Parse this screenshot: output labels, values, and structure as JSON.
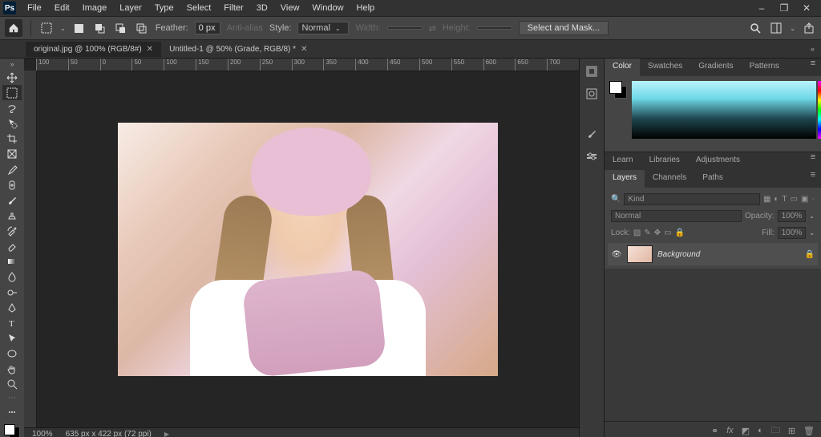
{
  "menu": [
    "File",
    "Edit",
    "Image",
    "Layer",
    "Type",
    "Select",
    "Filter",
    "3D",
    "View",
    "Window",
    "Help"
  ],
  "options": {
    "feather_label": "Feather:",
    "feather_value": "0 px",
    "antialias": "Anti-alias",
    "style_label": "Style:",
    "style_value": "Normal",
    "width_label": "Width:",
    "height_label": "Height:",
    "mask_button": "Select and Mask..."
  },
  "tabs": [
    {
      "title": "original.jpg @ 100% (RGB/8#)",
      "active": true
    },
    {
      "title": "Untitled-1 @ 50% (Grade, RGB/8) *",
      "active": false
    }
  ],
  "ruler_ticks": [
    "100",
    "50",
    "0",
    "50",
    "100",
    "150",
    "200",
    "250",
    "300",
    "350",
    "400",
    "450",
    "500",
    "550",
    "600",
    "650",
    "700"
  ],
  "status": {
    "zoom": "100%",
    "dims": "635 px x 422 px (72 ppi)"
  },
  "right": {
    "color_tabs": [
      "Color",
      "Swatches",
      "Gradients",
      "Patterns"
    ],
    "mid_tabs": [
      "Learn",
      "Libraries",
      "Adjustments"
    ],
    "layer_tabs": [
      "Layers",
      "Channels",
      "Paths"
    ],
    "kind_label": "Kind",
    "blend_mode": "Normal",
    "opacity_label": "Opacity:",
    "opacity_value": "100%",
    "lock_label": "Lock:",
    "fill_label": "Fill:",
    "fill_value": "100%",
    "layer_name": "Background"
  }
}
